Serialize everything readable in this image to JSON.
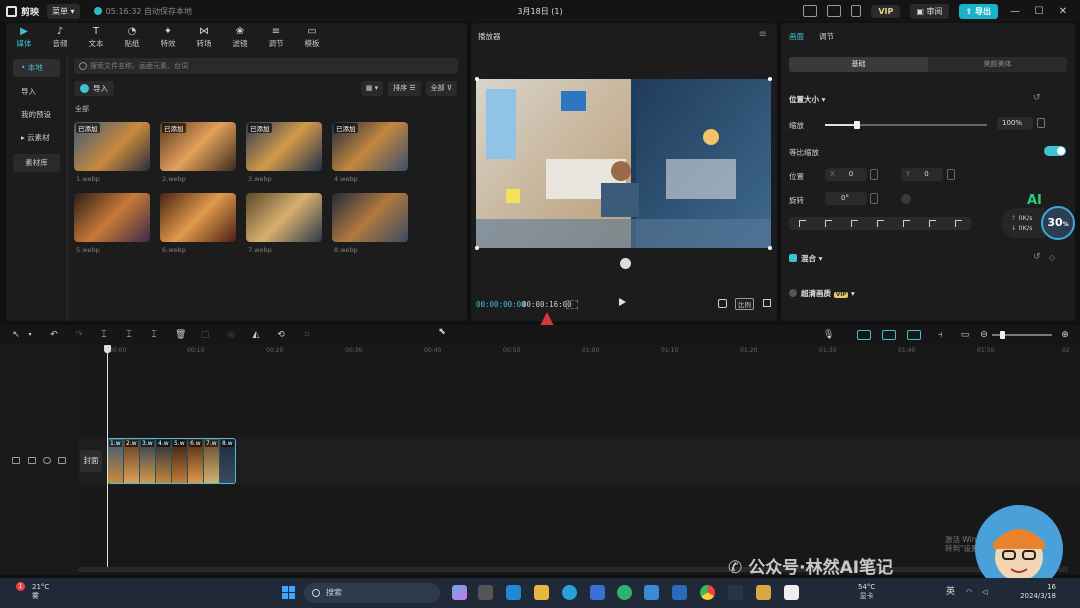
{
  "app": {
    "name": "剪映",
    "menu_label": "菜单",
    "save_status": "05:16:32 自动保存本地",
    "title": "3月18日 (1)",
    "vip_label": "VIP",
    "review_label": "审阅",
    "export_label": "导出"
  },
  "toolbar_tabs": [
    {
      "label": "媒体",
      "icon": "media-icon",
      "active": true
    },
    {
      "label": "音频",
      "icon": "audio-icon"
    },
    {
      "label": "文本",
      "icon": "text-icon"
    },
    {
      "label": "贴纸",
      "icon": "sticker-icon"
    },
    {
      "label": "特效",
      "icon": "effects-icon"
    },
    {
      "label": "转场",
      "icon": "transition-icon"
    },
    {
      "label": "滤镜",
      "icon": "filter-icon"
    },
    {
      "label": "调节",
      "icon": "adjust-icon"
    },
    {
      "label": "模板",
      "icon": "template-icon"
    }
  ],
  "side_nav": [
    {
      "label": "• 本地",
      "active": true
    },
    {
      "label": "导入"
    },
    {
      "label": "我的预设"
    },
    {
      "label": "▸ 云素材"
    },
    {
      "label": "素材库"
    }
  ],
  "media": {
    "search_placeholder": "搜索文件名称、画面元素、台词",
    "import_label": "导入",
    "sort_label": "排序",
    "filter_label": "全部",
    "section_label": "全部",
    "added_badge": "已添加",
    "items": [
      {
        "name": "1.webp",
        "added": true
      },
      {
        "name": "2.webp",
        "added": true
      },
      {
        "name": "3.webp",
        "added": true
      },
      {
        "name": "4.webp",
        "added": true
      },
      {
        "name": "5.webp",
        "added": false
      },
      {
        "name": "6.webp",
        "added": false
      },
      {
        "name": "7.webp",
        "added": false
      },
      {
        "name": "8.webp",
        "added": false
      }
    ]
  },
  "player": {
    "title": "播放器",
    "current_time": "00:00:00:00",
    "total_time": "00:00:16:00",
    "ratio_label": "比例"
  },
  "inspector": {
    "tabs": [
      "画面",
      "调节"
    ],
    "segments": [
      "基础",
      "美颜美体"
    ],
    "section_position": "位置大小",
    "scale_label": "缩放",
    "scale_value": "100%",
    "scale_fraction": 0.2,
    "uniform_scale_label": "等比缩放",
    "position_label": "位置",
    "pos_x_prefix": "X",
    "pos_x": "0",
    "pos_y_prefix": "Y",
    "pos_y": "0",
    "rotate_label": "旋转",
    "rotate_value": "0°",
    "blend_label": "混合",
    "hd_label": "超清画质",
    "hd_vip": "VIP"
  },
  "net_widget": {
    "ai": "AI",
    "up": "0K/s",
    "down": "0K/s",
    "percent": "30",
    "percent_unit": "%"
  },
  "timeline": {
    "ticks": [
      "00:00",
      "00:10",
      "00:20",
      "00:30",
      "00:40",
      "00:50",
      "01:00",
      "01:10",
      "01:20",
      "01:30",
      "01:40",
      "01:50",
      "02"
    ],
    "cover_label": "封面",
    "clips": [
      "1.w",
      "2.w",
      "3.w",
      "4.w",
      "5.w",
      "6.w",
      "7.w",
      "8.w"
    ]
  },
  "overlay": {
    "activate_windows_line1": "激活 Windows",
    "activate_windows_line2": "转到\"设置\"以激活 Windows。",
    "wechat_watermark": "公众号·林然AI笔记"
  },
  "taskbar": {
    "weather_temp": "21°C",
    "weather_desc": "雾",
    "weather_badge": "1",
    "search_label": "搜索",
    "cpu_temp": "54°C",
    "cpu_label": "显卡",
    "ime": "英",
    "time": "16",
    "date": "2024/3/18"
  },
  "colors": {
    "accent": "#3cc3d4",
    "export": "#18b3c7",
    "arrow": "#d23a3a"
  }
}
